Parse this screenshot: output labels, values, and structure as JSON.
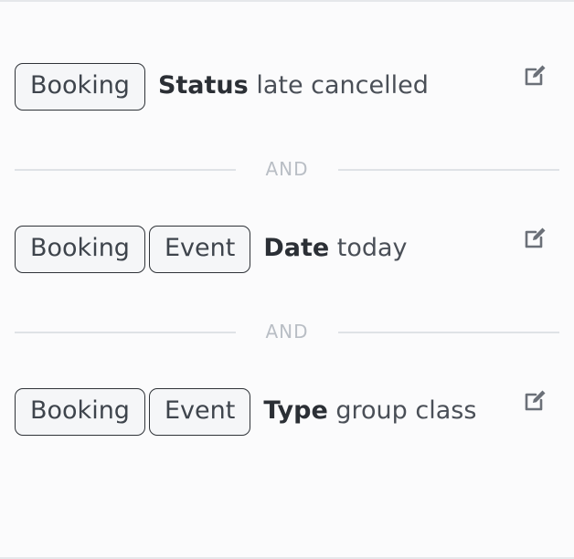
{
  "filters": [
    {
      "chips": [
        "Booking"
      ],
      "field": "Status",
      "value": "late cancelled",
      "edit_icon": "edit-icon"
    },
    {
      "chips": [
        "Booking",
        "Event"
      ],
      "field": "Date",
      "value": "today",
      "edit_icon": "edit-icon"
    },
    {
      "chips": [
        "Booking",
        "Event"
      ],
      "field": "Type",
      "value": "group class",
      "edit_icon": "edit-icon"
    }
  ],
  "dividers": [
    "AND",
    "AND"
  ],
  "colors": {
    "background": "#fbfbfc",
    "chip_border": "#2f3338",
    "divider_line": "#dfe2e6",
    "divider_text": "#b9bec5",
    "icon": "#6b7078"
  }
}
